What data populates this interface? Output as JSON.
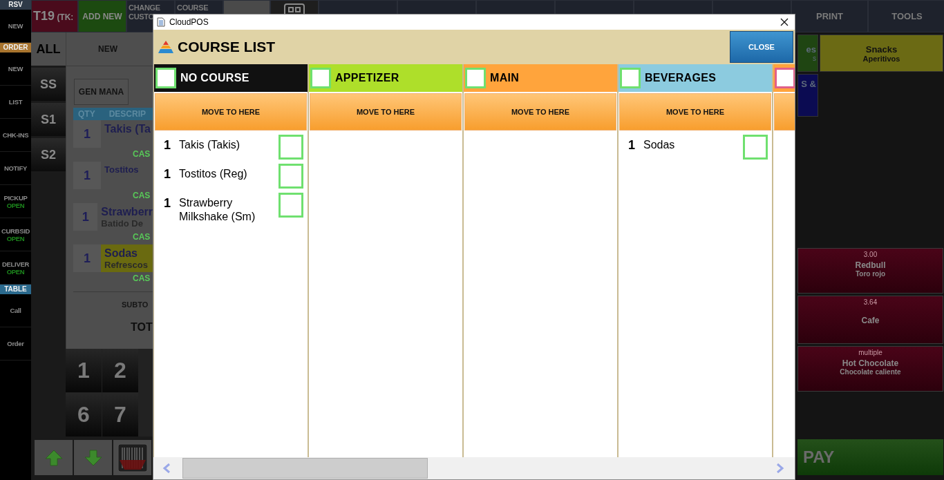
{
  "sidebar": [
    {
      "kind": "label",
      "text": "RSV",
      "color": "#2e3a48"
    },
    {
      "kind": "item",
      "text": "NEW"
    },
    {
      "kind": "label",
      "text": "ORDER",
      "color": "#a8742e"
    },
    {
      "kind": "item",
      "text": "NEW"
    },
    {
      "kind": "item",
      "text": "LIST"
    },
    {
      "kind": "item",
      "text": "CHK-INS"
    },
    {
      "kind": "item",
      "text": "NOTIFY"
    },
    {
      "kind": "item",
      "text": "PICKUP",
      "status": "OPEN"
    },
    {
      "kind": "item",
      "text": "CURBSID",
      "status": "OPEN"
    },
    {
      "kind": "item",
      "text": "DELIVER",
      "status": "OPEN"
    },
    {
      "kind": "label",
      "text": "TABLE",
      "color": "#2b6a8e"
    },
    {
      "kind": "item",
      "text": "Call"
    },
    {
      "kind": "item",
      "text": "Order"
    }
  ],
  "top_bar": [
    {
      "kind": "ticket",
      "text": "T19",
      "sub": "(TK:"
    },
    {
      "kind": "add",
      "text": "ADD NEW"
    },
    {
      "kind": "dark",
      "lines": [
        "CHANGE",
        "CUSTO"
      ]
    },
    {
      "kind": "dark",
      "lines": [
        "COURSE"
      ]
    },
    {
      "kind": "blank"
    },
    {
      "kind": "icon"
    },
    {
      "kind": "dark"
    },
    {
      "kind": "dark"
    },
    {
      "kind": "dark"
    },
    {
      "kind": "dark"
    },
    {
      "kind": "dark"
    },
    {
      "kind": "dark"
    },
    {
      "kind": "dark",
      "lines": [
        "PRINT"
      ]
    },
    {
      "kind": "dark",
      "lines": [
        "TOOLS"
      ]
    }
  ],
  "seats": [
    {
      "label": "ALL",
      "selected": true
    },
    {
      "label": "SS",
      "selected": false
    },
    {
      "label": "S1",
      "selected": false
    },
    {
      "label": "S2",
      "selected": false
    }
  ],
  "ticket": {
    "tab": "NEW",
    "button": "GEN MANA",
    "columns": [
      "QTY",
      "DESCRIP"
    ],
    "rows": [
      {
        "qty": "1",
        "name": "Takis (Ta",
        "payment": "CAS",
        "highlighted": false
      },
      {
        "qty": "1",
        "name": "Tostitos",
        "payment": "CAS",
        "highlighted": false
      },
      {
        "qty": "1",
        "name": "Strawberr",
        "sub": "Batido De",
        "payment": "CAS",
        "highlighted": false
      },
      {
        "qty": "1",
        "name": "Sodas",
        "sub": "Refrescos",
        "payment": "CAS",
        "highlighted": true
      }
    ],
    "subtotal_label": "SUBTO",
    "total_label": "TOT"
  },
  "numpad": [
    {
      "text": "1"
    },
    {
      "text": "2"
    },
    {
      "text": "6"
    },
    {
      "text": "7"
    }
  ],
  "bottom_buttons": [
    {
      "kind": "up"
    },
    {
      "kind": "down"
    },
    {
      "kind": "barcode"
    }
  ],
  "menu": {
    "categories": [
      {
        "text": "es",
        "sub": "s",
        "color": "#1f4512"
      },
      {
        "title": "Snacks",
        "subtitle": "Aperitivos",
        "color": "#6b6a14"
      },
      {
        "text": "S &",
        "color": "#0b0b52"
      }
    ],
    "items": [
      {
        "price": "3.00",
        "name": "Redbull",
        "subtitle": "Toro rojo"
      },
      {
        "price": "3.64",
        "name": "Cafe"
      },
      {
        "price": "multiple",
        "name": "Hot Chocolate",
        "subtitle": "Chocolate caliente"
      }
    ],
    "pay": "PAY"
  },
  "dialog": {
    "title": "CloudPOS",
    "heading": "COURSE LIST",
    "close": "CLOSE",
    "courses": [
      {
        "name": "NO COURSE",
        "color": "#111111",
        "checked": false,
        "action": "MOVE TO HERE",
        "items": [
          {
            "qty": "1",
            "name": "Takis (Takis)",
            "checked": false
          },
          {
            "qty": "1",
            "name": "Tostitos (Reg)",
            "checked": false
          },
          {
            "qty": "1",
            "name": "Strawberry Milkshake (Sm)",
            "checked": false
          }
        ]
      },
      {
        "name": "APPETIZER",
        "color": "#aedf2a",
        "checked": false,
        "action": "MOVE TO HERE"
      },
      {
        "name": "MAIN",
        "color": "#ffa43c",
        "checked": false,
        "action": "MOVE TO HERE"
      },
      {
        "name": "BEVERAGES",
        "color": "#8ccbdf",
        "checked": false,
        "action": "MOVE TO HERE",
        "items": [
          {
            "qty": "1",
            "name": "Sodas",
            "checked": false
          }
        ]
      },
      {
        "color": "#ffa43c",
        "checked": false
      }
    ]
  }
}
